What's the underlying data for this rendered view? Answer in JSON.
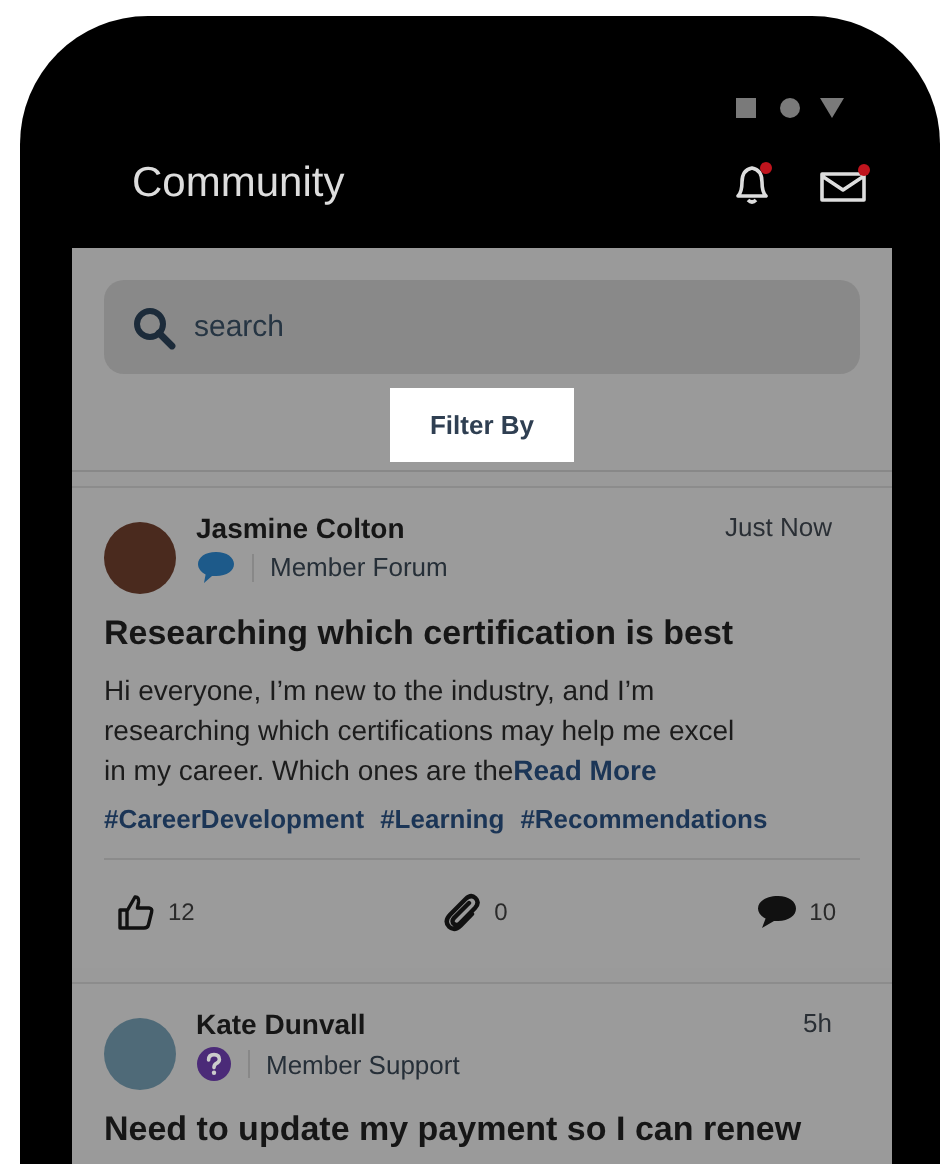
{
  "header": {
    "title": "Community",
    "notifications_badge": true,
    "messages_badge": true
  },
  "search": {
    "placeholder": "search"
  },
  "filter_button": {
    "label": "Filter By"
  },
  "posts": [
    {
      "author": "Jasmine Colton",
      "time": "Just Now",
      "kind": "forum",
      "category": "Member Forum",
      "title": "Researching which certification is best",
      "body": "Hi everyone, I’m new to the industry, and I’m researching which certifications may help me excel in my career. Which ones are the",
      "read_more": "Read More",
      "tags": [
        "#CareerDevelopment",
        "#Learning",
        "#Recommendations"
      ],
      "likes": "12",
      "attachments": "0",
      "comments": "10"
    },
    {
      "author": "Kate Dunvall",
      "time": "5h",
      "kind": "support",
      "category": "Member Support",
      "title": "Need to update my payment so I can renew"
    }
  ]
}
